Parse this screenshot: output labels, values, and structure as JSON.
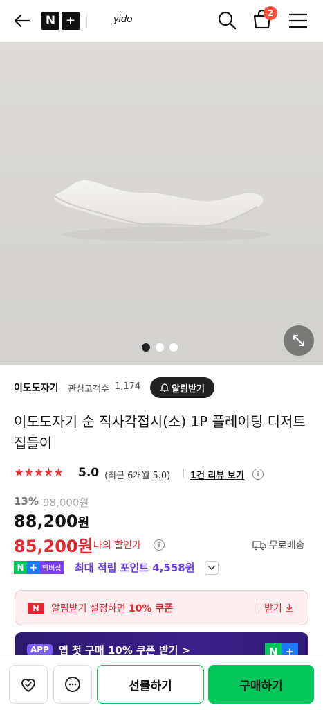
{
  "header": {
    "logo_n": "N",
    "logo_plus": "+",
    "store_name": "yido",
    "cart_count": "2"
  },
  "gallery": {
    "total_images": 3,
    "active_index": 0
  },
  "seller": {
    "name": "이도도자기",
    "follower_label": "관심고객수",
    "follower_count": "1,174",
    "alarm_label": "알림받기"
  },
  "product": {
    "title": "이도도자기 순 직사각접시(소) 1P 플레이팅 디저트 집들이"
  },
  "rating": {
    "stars": "★★★★★",
    "score": "5.0",
    "period": "(최근 6개월 5.0)",
    "review_link": "1건 리뷰 보기"
  },
  "price": {
    "discount_rate": "13%",
    "original": "98,000원",
    "sale": "88,200",
    "sale_unit": "원",
    "my_price": "85,200원",
    "my_price_label": "나의 할인가",
    "shipping": "무료배송"
  },
  "membership": {
    "n": "N",
    "plus": "+",
    "badge": "멤버십",
    "points_text": "최대 적립 포인트 4,558원"
  },
  "coupon": {
    "n": "N",
    "text_prefix": "알림받기 설정하면 ",
    "text_bold": "10% 쿠폰",
    "action": "받기"
  },
  "app_banner": {
    "badge": "APP",
    "text": "앱 첫 구매 10% 쿠폰 받기 >",
    "logo_n": "N",
    "logo_plus": "+"
  },
  "bottom_bar": {
    "gift_label": "선물하기",
    "buy_label": "구매하기"
  },
  "colors": {
    "naver_green": "#03c75a",
    "price_red": "#e3262f",
    "points_purple": "#6a3de8",
    "star_red": "#e83a3a"
  }
}
